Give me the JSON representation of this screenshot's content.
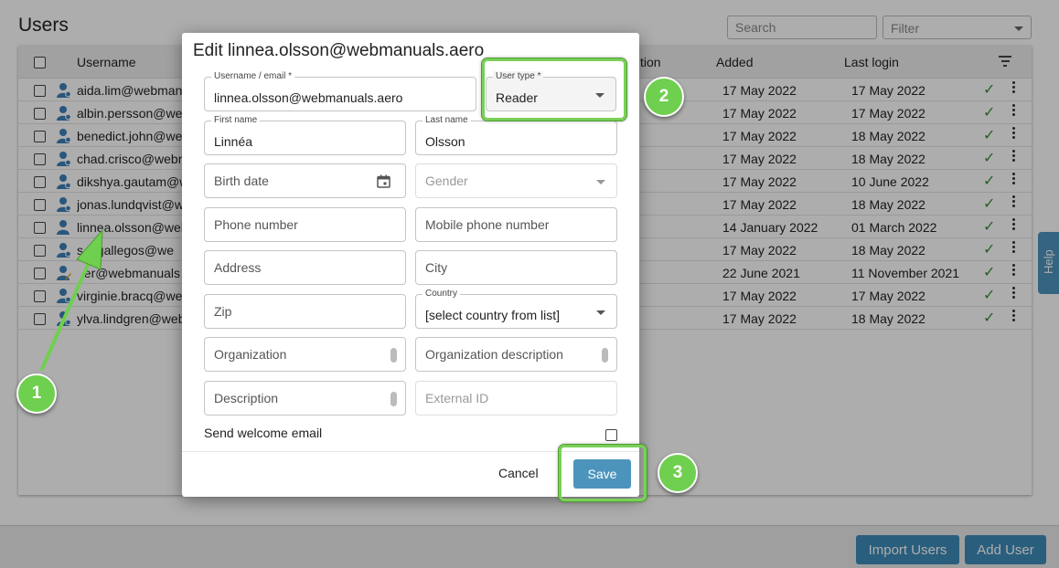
{
  "page": {
    "title": "Users",
    "search_placeholder": "Search",
    "filter_placeholder": "Filter"
  },
  "table": {
    "columns": {
      "username": "Username",
      "description_partial": "tion",
      "added": "Added",
      "last_login": "Last login"
    },
    "rows": [
      {
        "username": "aida.lim@webmanu",
        "added": "17 May 2022",
        "last_login": "17 May 2022"
      },
      {
        "username": "albin.persson@web",
        "added": "17 May 2022",
        "last_login": "17 May 2022"
      },
      {
        "username": "benedict.john@web",
        "added": "17 May 2022",
        "last_login": "18 May 2022"
      },
      {
        "username": "chad.crisco@webm",
        "added": "17 May 2022",
        "last_login": "18 May 2022"
      },
      {
        "username": "dikshya.gautam@w",
        "added": "17 May 2022",
        "last_login": "10 June 2022"
      },
      {
        "username": "jonas.lundqvist@w",
        "added": "17 May 2022",
        "last_login": "18 May 2022"
      },
      {
        "username": "linnea.olsson@web",
        "added": "14 January 2022",
        "last_login": "01 March 2022"
      },
      {
        "username": "s  i.gallegos@we",
        "added": "17 May 2022",
        "last_login": "18 May 2022"
      },
      {
        "username": "  er@webmanuals",
        "added": "22 June 2021",
        "last_login": "11 November 2021"
      },
      {
        "username": "virginie.bracq@we",
        "added": "17 May 2022",
        "last_login": "17 May 2022"
      },
      {
        "username": "ylva.lindgren@web",
        "added": "17 May 2022",
        "last_login": "18 May 2022"
      }
    ]
  },
  "buttons": {
    "import_users": "Import Users",
    "add_user": "Add User",
    "help": "Help"
  },
  "modal": {
    "title": "Edit linnea.olsson@webmanuals.aero",
    "fields": {
      "username_label": "Username / email *",
      "username_value": "linnea.olsson@webmanuals.aero",
      "user_type_label": "User type *",
      "user_type_value": "Reader",
      "first_name_label": "First name",
      "first_name_value": "Linnéa",
      "last_name_label": "Last name",
      "last_name_value": "Olsson",
      "birth_date": "Birth date",
      "gender": "Gender",
      "phone": "Phone number",
      "mobile": "Mobile phone number",
      "address": "Address",
      "city": "City",
      "zip": "Zip",
      "country_label": "Country",
      "country_value": "[select country from list]",
      "organization": "Organization",
      "organization_description": "Organization description",
      "description": "Description",
      "external_id": "External ID"
    },
    "send_welcome_email": "Send welcome email",
    "cancel": "Cancel",
    "save": "Save"
  },
  "annotations": {
    "step1": "1",
    "step2": "2",
    "step3": "3",
    "color": "#6fcf4f"
  }
}
